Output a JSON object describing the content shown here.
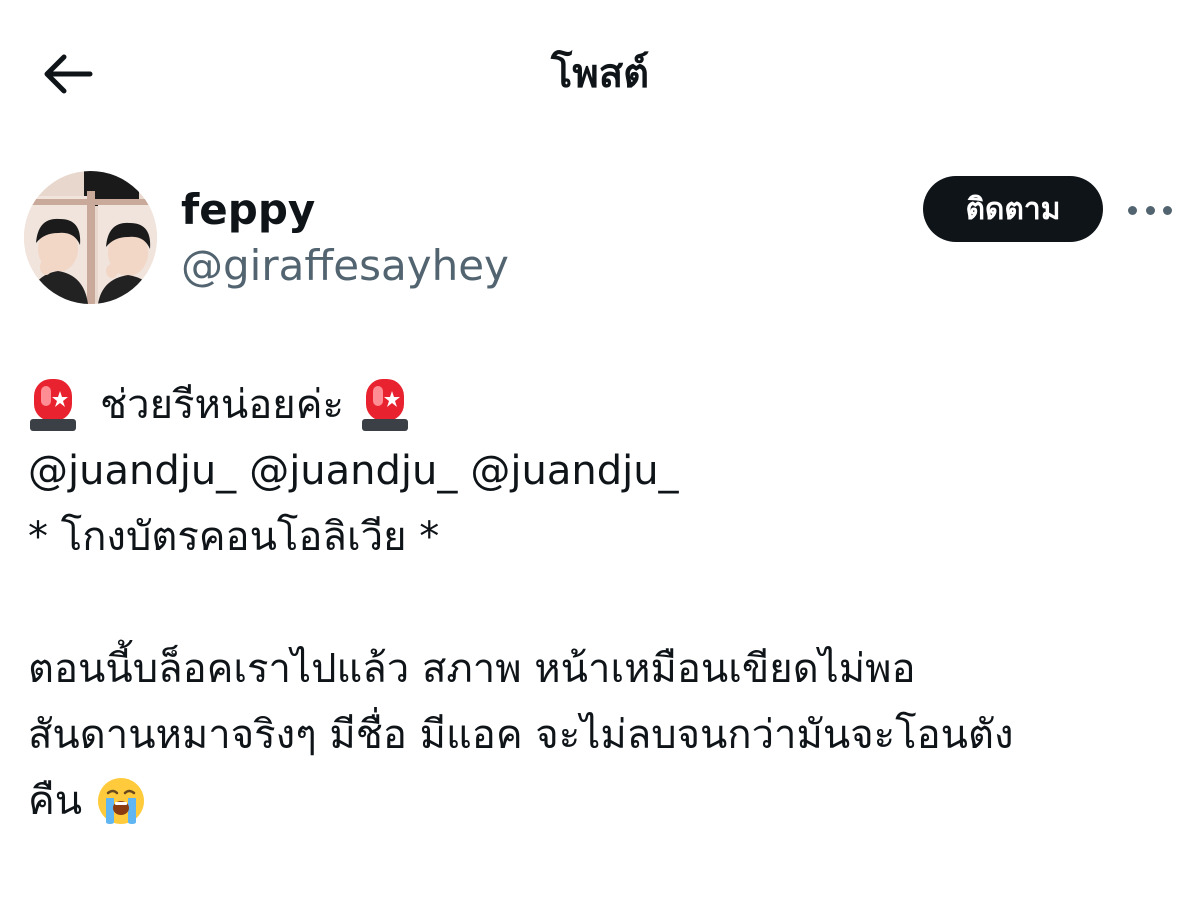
{
  "header": {
    "title": "โพสต์"
  },
  "author": {
    "display_name": "feppy",
    "handle": "@giraffesayhey",
    "follow_label": "ติดตาม"
  },
  "post": {
    "heading": "ช่วยรีหน่อยค่ะ",
    "mentions": [
      "@juandju_",
      "@juandju_",
      "@juandju_"
    ],
    "line_scam": "* โกงบัตรคอนโอลิเวีย *",
    "line_1": "ตอนนี้บล็อคเราไปแล้ว สภาพ หน้าเหมือนเขียดไม่พอ",
    "line_2": "สันดานหมาจริงๆ มีชื่อ มีแอค จะไม่ลบจนกว่ามันจะโอนตัง",
    "line_3": "คืน",
    "emojis": {
      "siren": "police-car-light",
      "crying": "loudly-crying-face"
    }
  },
  "colors": {
    "text_primary": "#0f1419",
    "text_secondary": "#536471",
    "follow_button_bg": "#0f1419",
    "follow_button_text": "#ffffff"
  }
}
